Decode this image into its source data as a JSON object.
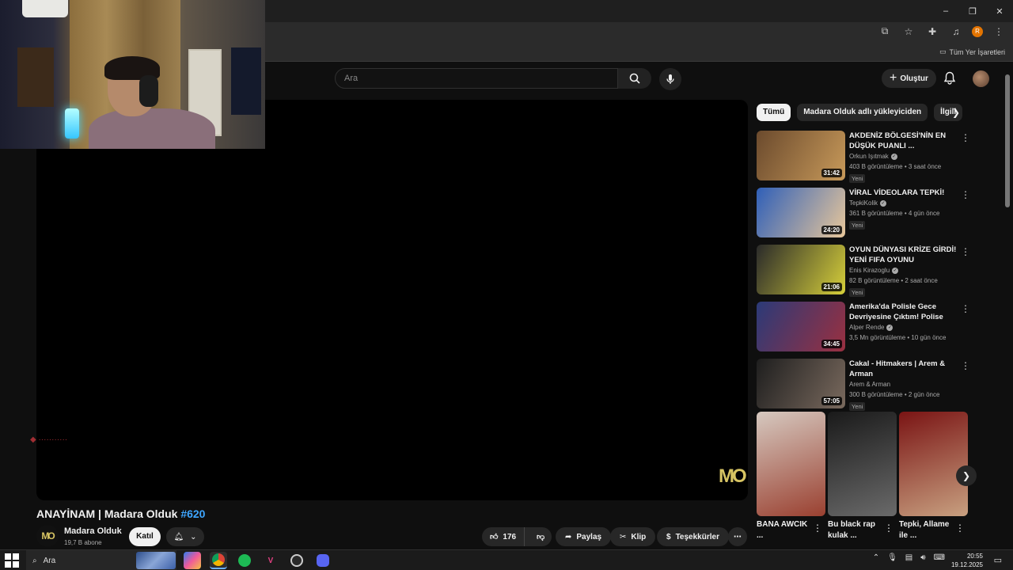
{
  "browser": {
    "bookmarks_all": "Tüm Yer İşaretleri",
    "profile_initial": "R",
    "window_controls": [
      "–",
      "❐",
      "✕"
    ]
  },
  "youtube": {
    "search_placeholder": "Ara",
    "create_label": "Oluştur"
  },
  "video": {
    "title": "ANAYİNAM | Madara Olduk",
    "title_tag": "#620",
    "logo_text": "MO",
    "channel_name": "Madara Olduk",
    "subscribers": "19,7 B abone",
    "join_label": "Katıl",
    "likes": "176",
    "share_label": "Paylaş",
    "clip_label": "Klip",
    "thanks_label": "Teşekkürler"
  },
  "chips": [
    {
      "label": "Tümü",
      "active": true
    },
    {
      "label": "Madara Olduk adlı yükleyiciden",
      "active": false
    },
    {
      "label": "İlgili",
      "active": false
    }
  ],
  "recommendations": [
    {
      "title": "AKDENİZ BÖLGESİ'NİN EN DÜŞÜK PUANLI ...",
      "channel": "Orkun Işıtmak",
      "verified": true,
      "meta": "403 B görüntüleme • 3 saat önce",
      "badge": "Yeni",
      "duration": "31:42",
      "thumb_colors": [
        "#6b4a2d",
        "#c89a5a"
      ]
    },
    {
      "title": "VİRAL VİDEOLARA TEPKİ!",
      "channel": "TepkiKolik",
      "verified": true,
      "meta": "361 B görüntüleme • 4 gün önce",
      "badge": "Yeni",
      "duration": "24:20",
      "thumb_colors": [
        "#2f5fb8",
        "#e8c79a"
      ]
    },
    {
      "title": "OYUN DÜNYASI KRİZE GİRDİ! YENİ FIFA OYUNU DUYURULD...",
      "channel": "Enis Kirazoglu",
      "verified": true,
      "meta": "82 B görüntüleme • 2 saat önce",
      "badge": "Yeni",
      "duration": "21:06",
      "thumb_colors": [
        "#2a2a2a",
        "#d6cf3a"
      ]
    },
    {
      "title": "Amerika'da Polisle Gece Devriyesine Çıktım! Polise Küf...",
      "channel": "Alper Rende",
      "verified": true,
      "meta": "3,5 Mn görüntüleme • 10 gün önce",
      "badge": "",
      "duration": "34:45",
      "thumb_colors": [
        "#2b3a78",
        "#9a3040"
      ]
    },
    {
      "title": "Cakal - Hitmakers | Arem & Arman",
      "channel": "Arem & Arman",
      "verified": false,
      "meta": "300 B görüntüleme • 2 gün önce",
      "badge": "Yeni",
      "duration": "57:05",
      "thumb_colors": [
        "#1e1e1e",
        "#7a6a5e"
      ]
    }
  ],
  "shorts": [
    {
      "title": "BANA AWCIK ...",
      "thumb_colors": [
        "#d6c9c0",
        "#9a4030"
      ]
    },
    {
      "title": "Bu black rap kulak ...",
      "thumb_colors": [
        "#1a1a1a",
        "#6a6a6a"
      ]
    },
    {
      "title": "Tepki, Allame ile ...",
      "thumb_colors": [
        "#7a1414",
        "#c8a080"
      ]
    }
  ],
  "taskbar": {
    "search_label": "Ara",
    "time": "20:55",
    "date": "19.12.2025"
  }
}
